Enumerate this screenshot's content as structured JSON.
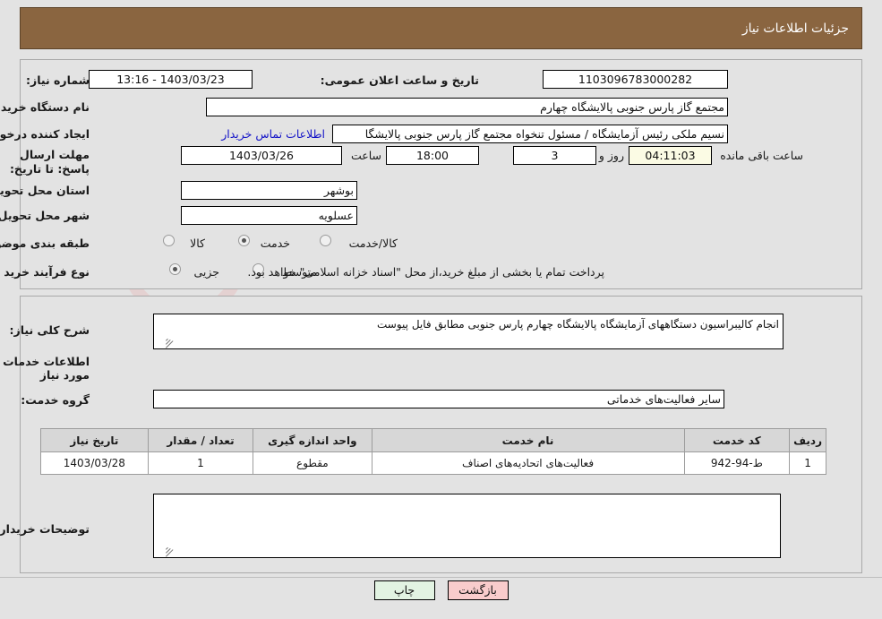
{
  "header": {
    "title": "جزئیات اطلاعات نیاز"
  },
  "top": {
    "need_no_label": "شماره نیاز:",
    "need_no_value": "1103096783000282",
    "public_announce_label": "تاریخ و ساعت اعلان عمومی:",
    "public_announce_value": "1403/03/23 - 13:16",
    "buyer_org_label": "نام دستگاه خریدار:",
    "buyer_org_value": "مجتمع گاز پارس جنوبی  پالایشگاه چهارم",
    "requester_label": "ایجاد کننده درخواست:",
    "requester_value": "نسیم ملکی رئیس آزمایشگاه / مسئول تنخواه مجتمع گاز پارس جنوبی  پالایشگا",
    "buyer_contact_link": "اطلاعات تماس خریدار",
    "deadline_label": "مهلت ارسال پاسخ: تا تاریخ:",
    "deadline_date": "1403/03/26",
    "hour_label": "ساعت",
    "hour_value": "18:00",
    "days_value": "3",
    "days_label": "روز و",
    "remaining_value": "04:11:03",
    "remaining_label": "ساعت باقی مانده",
    "province_label": "استان محل تحویل:",
    "province_value": "بوشهر",
    "city_label": "شهر محل تحویل:",
    "city_value": "عسلویه",
    "category_label": "طبقه بندی موضوعی:",
    "category_options": [
      {
        "label": "کالا",
        "selected": false
      },
      {
        "label": "خدمت",
        "selected": true
      },
      {
        "label": "کالا/خدمت",
        "selected": false
      }
    ],
    "process_label": "نوع فرآیند خرید :",
    "process_options": [
      {
        "label": "جزیی",
        "selected": true
      },
      {
        "label": "متوسط",
        "selected": false
      }
    ],
    "treasury_note": "پرداخت تمام یا بخشی از مبلغ خرید،از محل \"اسناد خزانه اسلامی\" خواهد بود."
  },
  "mid": {
    "general_desc_label": "شرح کلی نیاز:",
    "general_desc_value": "انجام کالیبراسیون دستگاههای آزمایشگاه پالایشگاه چهارم پارس جنوبی مطابق فایل پیوست",
    "services_section_title": "اطلاعات خدمات مورد نیاز",
    "service_group_label": "گروه خدمت:",
    "service_group_value": "سایر فعالیت‌های خدماتی",
    "buyer_notes_label": "توضیحات خریدار:",
    "buyer_notes_value": ""
  },
  "table": {
    "headers": [
      "ردیف",
      "کد خدمت",
      "نام خدمت",
      "واحد اندازه گیری",
      "تعداد / مقدار",
      "تاریخ نیاز"
    ],
    "rows": [
      [
        "1",
        "ط-94-942",
        "فعالیت‌های اتحادیه‌های اصناف",
        "مقطوع",
        "1",
        "1403/03/28"
      ]
    ]
  },
  "buttons": {
    "back": "بازگشت",
    "print": "چاپ"
  },
  "watermark": {
    "text": "AriaTender",
    "suffix": ".net"
  },
  "colors": {
    "header_bg": "#8a6540",
    "link": "#1414c8",
    "btn_back": "#f9cccc",
    "btn_print": "#e2f3e2",
    "countdown_bg": "#fbfbe4",
    "page_bg": "#e3e3e3"
  }
}
